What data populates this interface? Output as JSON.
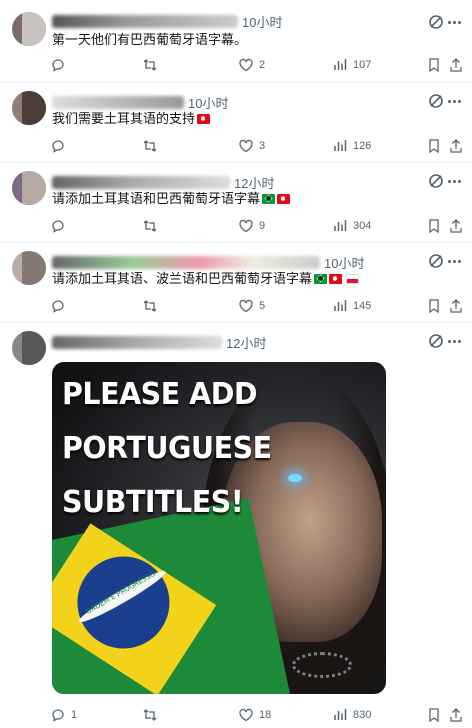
{
  "posts": [
    {
      "time": "10小时",
      "text": "第一天他们有巴西葡萄牙语字幕。",
      "flags": [],
      "replies": "",
      "reposts": "",
      "likes": "2",
      "views": "107"
    },
    {
      "time": "10小时",
      "text": "我们需要土耳其语的支持",
      "flags": [
        "tr"
      ],
      "replies": "",
      "reposts": "",
      "likes": "3",
      "views": "126"
    },
    {
      "time": "12小时",
      "text": "请添加土耳其语和巴西葡萄牙语字幕",
      "flags": [
        "br",
        "tr"
      ],
      "replies": "",
      "reposts": "",
      "likes": "9",
      "views": "304"
    },
    {
      "time": "10小时",
      "text": "请添加土耳其语、波兰语和巴西葡萄牙语字幕",
      "flags": [
        "br",
        "tr",
        "pl"
      ],
      "replies": "",
      "reposts": "",
      "likes": "5",
      "views": "145"
    },
    {
      "time": "12小时",
      "text": "",
      "flags": [],
      "image_lines": [
        "PLEASE ADD",
        "PORTUGUESE",
        "SUBTITLES!"
      ],
      "flag_motto": "ORDEM E PROGRESSO",
      "replies": "1",
      "reposts": "",
      "likes": "18",
      "views": "830"
    }
  ],
  "icons": {
    "reply": "reply-icon",
    "repost": "repost-icon",
    "like": "heart-icon",
    "views": "views-chart-icon",
    "bookmark": "bookmark-icon",
    "share": "share-icon",
    "grok": "grok-icon",
    "more": "more-icon"
  },
  "colors": {
    "text": "#0f1419",
    "muted": "#536471",
    "divider": "#eff3f4"
  }
}
